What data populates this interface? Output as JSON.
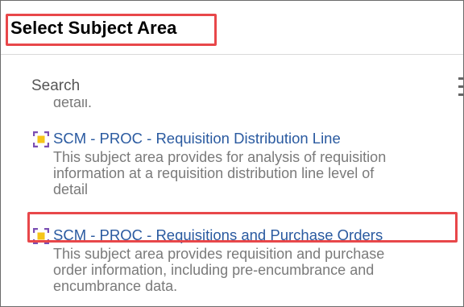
{
  "dialog": {
    "title": "Select Subject Area"
  },
  "search": {
    "placeholder": "Search"
  },
  "list": {
    "previous_item_tail": "detail.",
    "items": [
      {
        "icon": "subject-area-icon",
        "title": "SCM - PROC - Requisition Distribution Line",
        "description_lines": [
          "This subject area provides for analysis of requisition",
          "information at a requisition distribution line level of",
          "detail"
        ]
      },
      {
        "icon": "subject-area-icon",
        "title": "SCM - PROC - Requisitions and Purchase Orders",
        "description_lines": [
          "This subject area provides requisition and purchase",
          "order information, including pre-encumbrance and",
          "encumbrance data."
        ]
      }
    ]
  },
  "colors": {
    "highlight": "#e8474a",
    "link": "#2a5aa0",
    "description": "#7a7a7a",
    "icon_bracket": "#7b4fb3",
    "icon_center": "#f5c518"
  }
}
